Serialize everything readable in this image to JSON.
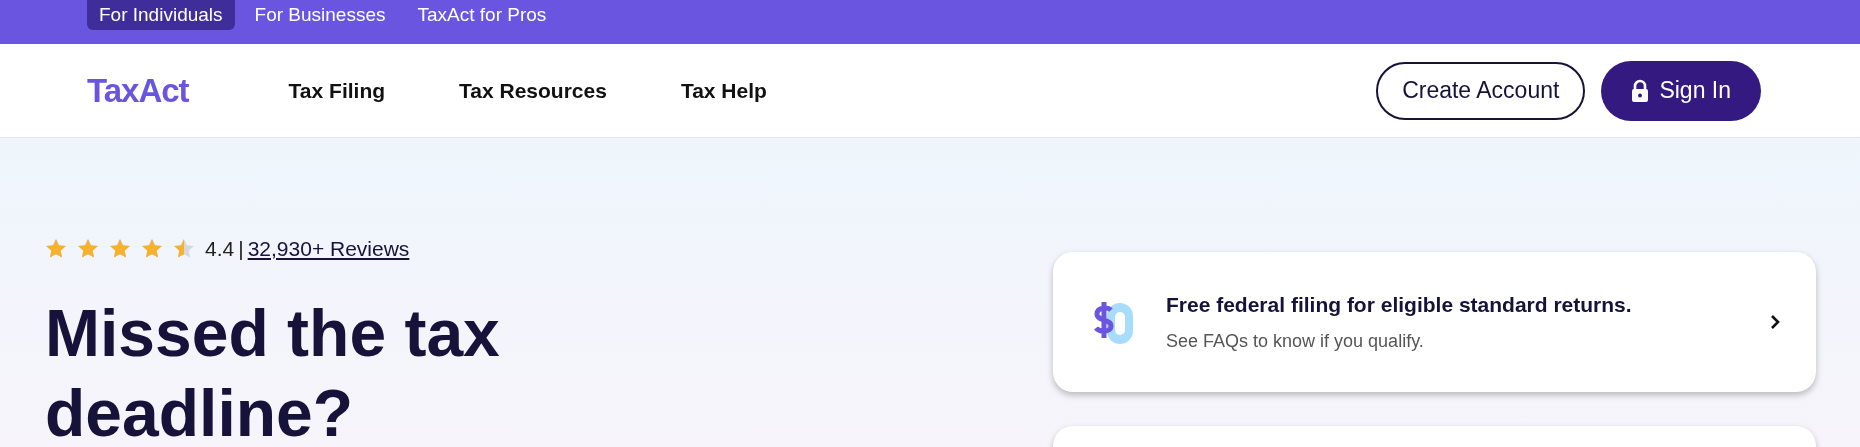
{
  "audience_tabs": [
    {
      "label": "For Individuals",
      "selected": true
    },
    {
      "label": "For Businesses",
      "selected": false
    },
    {
      "label": "TaxAct for Pros",
      "selected": false
    }
  ],
  "header": {
    "logo": "TaxAct",
    "nav": [
      "Tax Filing",
      "Tax Resources",
      "Tax Help"
    ],
    "create_account": "Create Account",
    "sign_in": "Sign In"
  },
  "hero": {
    "rating": {
      "stars": 4.4,
      "score": "4.4",
      "separator": "|",
      "reviews": "32,930+ Reviews"
    },
    "heading": "Missed the tax deadline?"
  },
  "cards": [
    {
      "kind": "offer",
      "title": "Free federal filing for eligible standard returns.",
      "subtitle": "See FAQs to know if you qualify."
    },
    {
      "kind": "blank"
    }
  ]
}
